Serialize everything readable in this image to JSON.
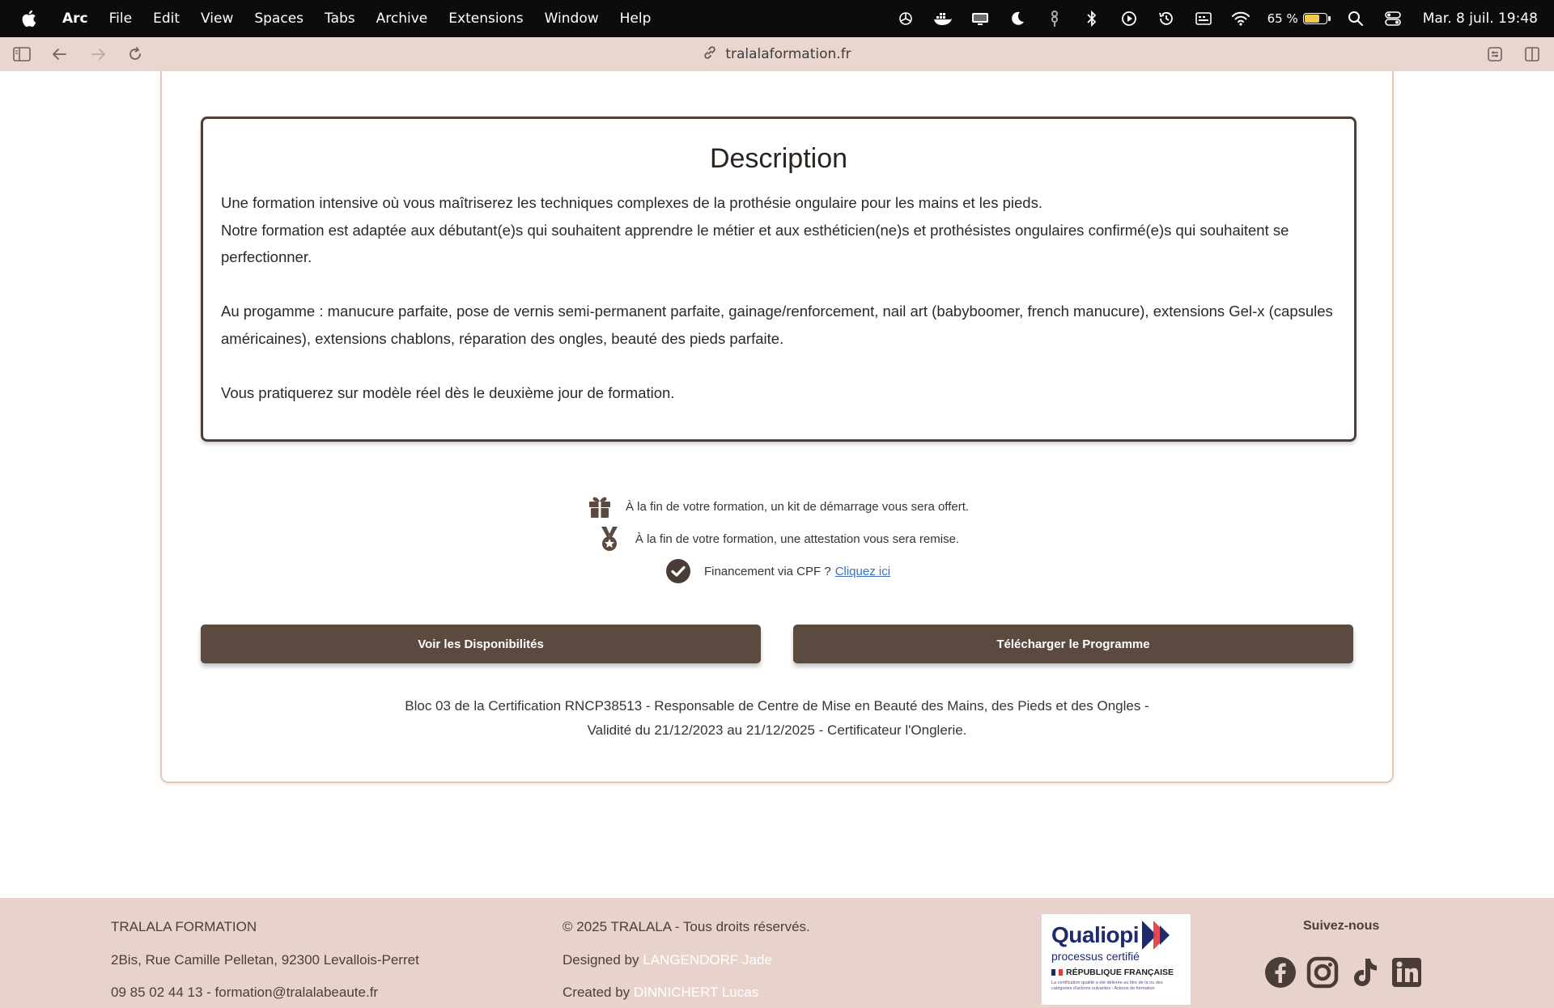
{
  "menubar": {
    "app": "Arc",
    "items": [
      "File",
      "Edit",
      "View",
      "Spaces",
      "Tabs",
      "Archive",
      "Extensions",
      "Window",
      "Help"
    ],
    "battery_percent": "65 %",
    "battery_level": 0.65,
    "clock": "Mar. 8 juil. 19:48"
  },
  "browser": {
    "url": "tralalaformation.fr"
  },
  "description": {
    "title": "Description",
    "p1": "Une formation intensive où vous maîtriserez les techniques complexes de la prothésie ongulaire pour les mains et les pieds.",
    "p2": "Notre formation est adaptée aux débutant(e)s qui souhaitent apprendre le métier et aux esthéticien(ne)s et prothésistes ongulaires confirmé(e)s qui souhaitent se perfectionner.",
    "p3": "Au progamme : manucure parfaite, pose de vernis semi-permanent parfaite, gainage/renforcement, nail art (babyboomer, french manucure), extensions Gel-x (capsules américaines), extensions chablons, réparation des ongles, beauté des pieds parfaite.",
    "p4": "Vous pratiquerez sur modèle réel dès le deuxième jour de formation."
  },
  "features": {
    "kit": "À la fin de votre formation, un kit de démarrage vous sera offert.",
    "attestation": "À la fin de votre formation, une attestation vous sera remise.",
    "cpf": "Financement via CPF ?",
    "cpf_link": "Cliquez ici"
  },
  "buttons": {
    "availability": "Voir les Disponibilités",
    "program": "Télécharger le Programme"
  },
  "certification": {
    "line1": "Bloc 03 de la Certification RNCP38513 - Responsable de Centre de Mise en Beauté des Mains, des Pieds et des Ongles -",
    "line2": "Validité du 21/12/2023 au 21/12/2025 - Certificateur l'Onglerie."
  },
  "footer": {
    "company": "TRALALA FORMATION",
    "address": "2Bis, Rue Camille Pelletan, 92300 Levallois-Perret",
    "contact": "09 85 02 44 13 - formation@tralalabeaute.fr",
    "copyright": "© 2025 TRALALA - Tous droits réservés.",
    "designed_prefix": "Designed by",
    "designer": "LANGENDORF Jade",
    "created_prefix": "Created by",
    "creator": "DINNICHERT Lucas",
    "qualiopi_title": "Qualiopi",
    "qualiopi_sub": "processus certifié",
    "qualiopi_rep": "RÉPUBLIQUE FRANÇAISE",
    "qualiopi_small": "La certification qualité a été délivrée au titre de la ou des catégories d'actions suivantes : Actions de formation",
    "social_title": "Suivez-nous"
  },
  "colors": {
    "accent_brown": "#5c4a41",
    "toolbar_pink": "#e9d6ce",
    "footer_pink": "#e7d3cb",
    "link_blue": "#3b6fc4"
  },
  "icons": [
    "apple-logo-icon",
    "openai-icon",
    "docker-icon",
    "display-icon",
    "moon-icon",
    "dots-icon",
    "bluetooth-icon",
    "play-icon",
    "time-machine-icon",
    "keyboard-icon",
    "wifi-icon",
    "battery-icon",
    "search-icon",
    "control-center-icon",
    "sidebar-toggle-icon",
    "back-arrow-icon",
    "forward-arrow-icon",
    "reload-icon",
    "link-icon",
    "extensions-icon",
    "split-view-icon",
    "gift-icon",
    "medal-icon",
    "check-circle-icon",
    "facebook-icon",
    "instagram-icon",
    "tiktok-icon",
    "linkedin-icon"
  ]
}
